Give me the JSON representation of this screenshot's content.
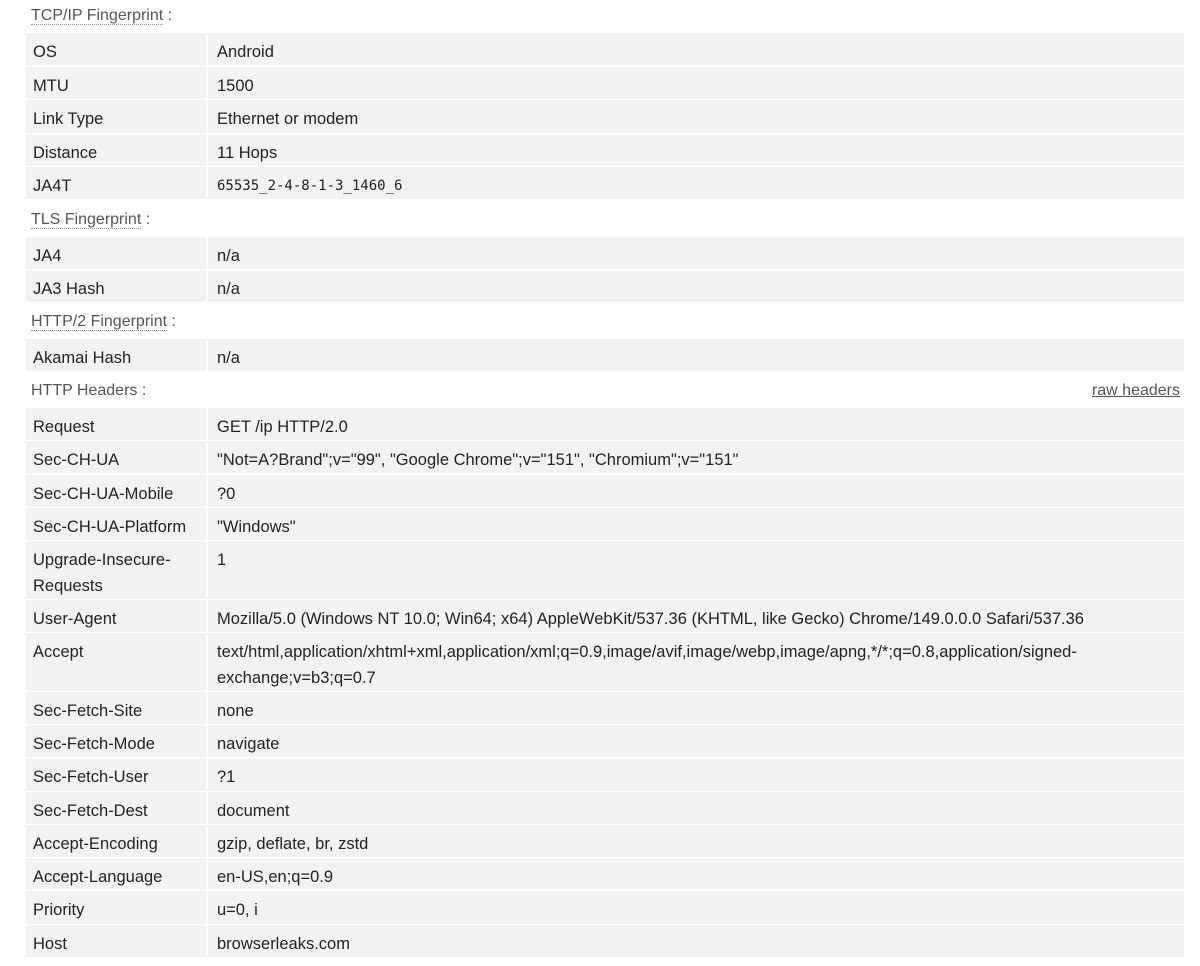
{
  "sections": {
    "tcpip": {
      "title": "TCP/IP Fingerprint",
      "colon": " :"
    },
    "tls": {
      "title": "TLS Fingerprint",
      "colon": " :"
    },
    "http2": {
      "title": "HTTP/2 Fingerprint",
      "colon": " :"
    },
    "headers": {
      "title": "HTTP Headers",
      "colon": " :",
      "raw_link": "raw headers"
    }
  },
  "tcpip_rows": [
    {
      "key": "OS",
      "value": "Android"
    },
    {
      "key": "MTU",
      "value": "1500"
    },
    {
      "key": "Link Type",
      "value": "Ethernet or modem"
    },
    {
      "key": "Distance",
      "value": "11 Hops"
    },
    {
      "key": "JA4T",
      "value": "65535_2-4-8-1-3_1460_6"
    }
  ],
  "tls_rows": [
    {
      "key": "JA4",
      "value": "n/a"
    },
    {
      "key": "JA3 Hash",
      "value": "n/a"
    }
  ],
  "http2_rows": [
    {
      "key": "Akamai Hash",
      "value": "n/a"
    }
  ],
  "header_rows": [
    {
      "key": "Request",
      "value": "GET /ip HTTP/2.0"
    },
    {
      "key": "Sec-CH-UA",
      "value": "\"Not=A?Brand\";v=\"99\", \"Google Chrome\";v=\"151\", \"Chromium\";v=\"151\""
    },
    {
      "key": "Sec-CH-UA-Mobile",
      "value": "?0"
    },
    {
      "key": "Sec-CH-UA-Platform",
      "value": "\"Windows\""
    },
    {
      "key": "Upgrade-Insecure-Requests",
      "value": "1"
    },
    {
      "key": "User-Agent",
      "value": "Mozilla/5.0 (Windows NT 10.0; Win64; x64) AppleWebKit/537.36 (KHTML, like Gecko) Chrome/149.0.0.0 Safari/537.36"
    },
    {
      "key": "Accept",
      "value": "text/html,application/xhtml+xml,application/xml;q=0.9,image/avif,image/webp,image/apng,*/*;q=0.8,application/signed-exchange;v=b3;q=0.7"
    },
    {
      "key": "Sec-Fetch-Site",
      "value": "none"
    },
    {
      "key": "Sec-Fetch-Mode",
      "value": "navigate"
    },
    {
      "key": "Sec-Fetch-User",
      "value": "?1"
    },
    {
      "key": "Sec-Fetch-Dest",
      "value": "document"
    },
    {
      "key": "Accept-Encoding",
      "value": "gzip, deflate, br, zstd"
    },
    {
      "key": "Accept-Language",
      "value": "en-US,en;q=0.9"
    },
    {
      "key": "Priority",
      "value": "u=0, i"
    },
    {
      "key": "Host",
      "value": "browserleaks.com"
    }
  ]
}
